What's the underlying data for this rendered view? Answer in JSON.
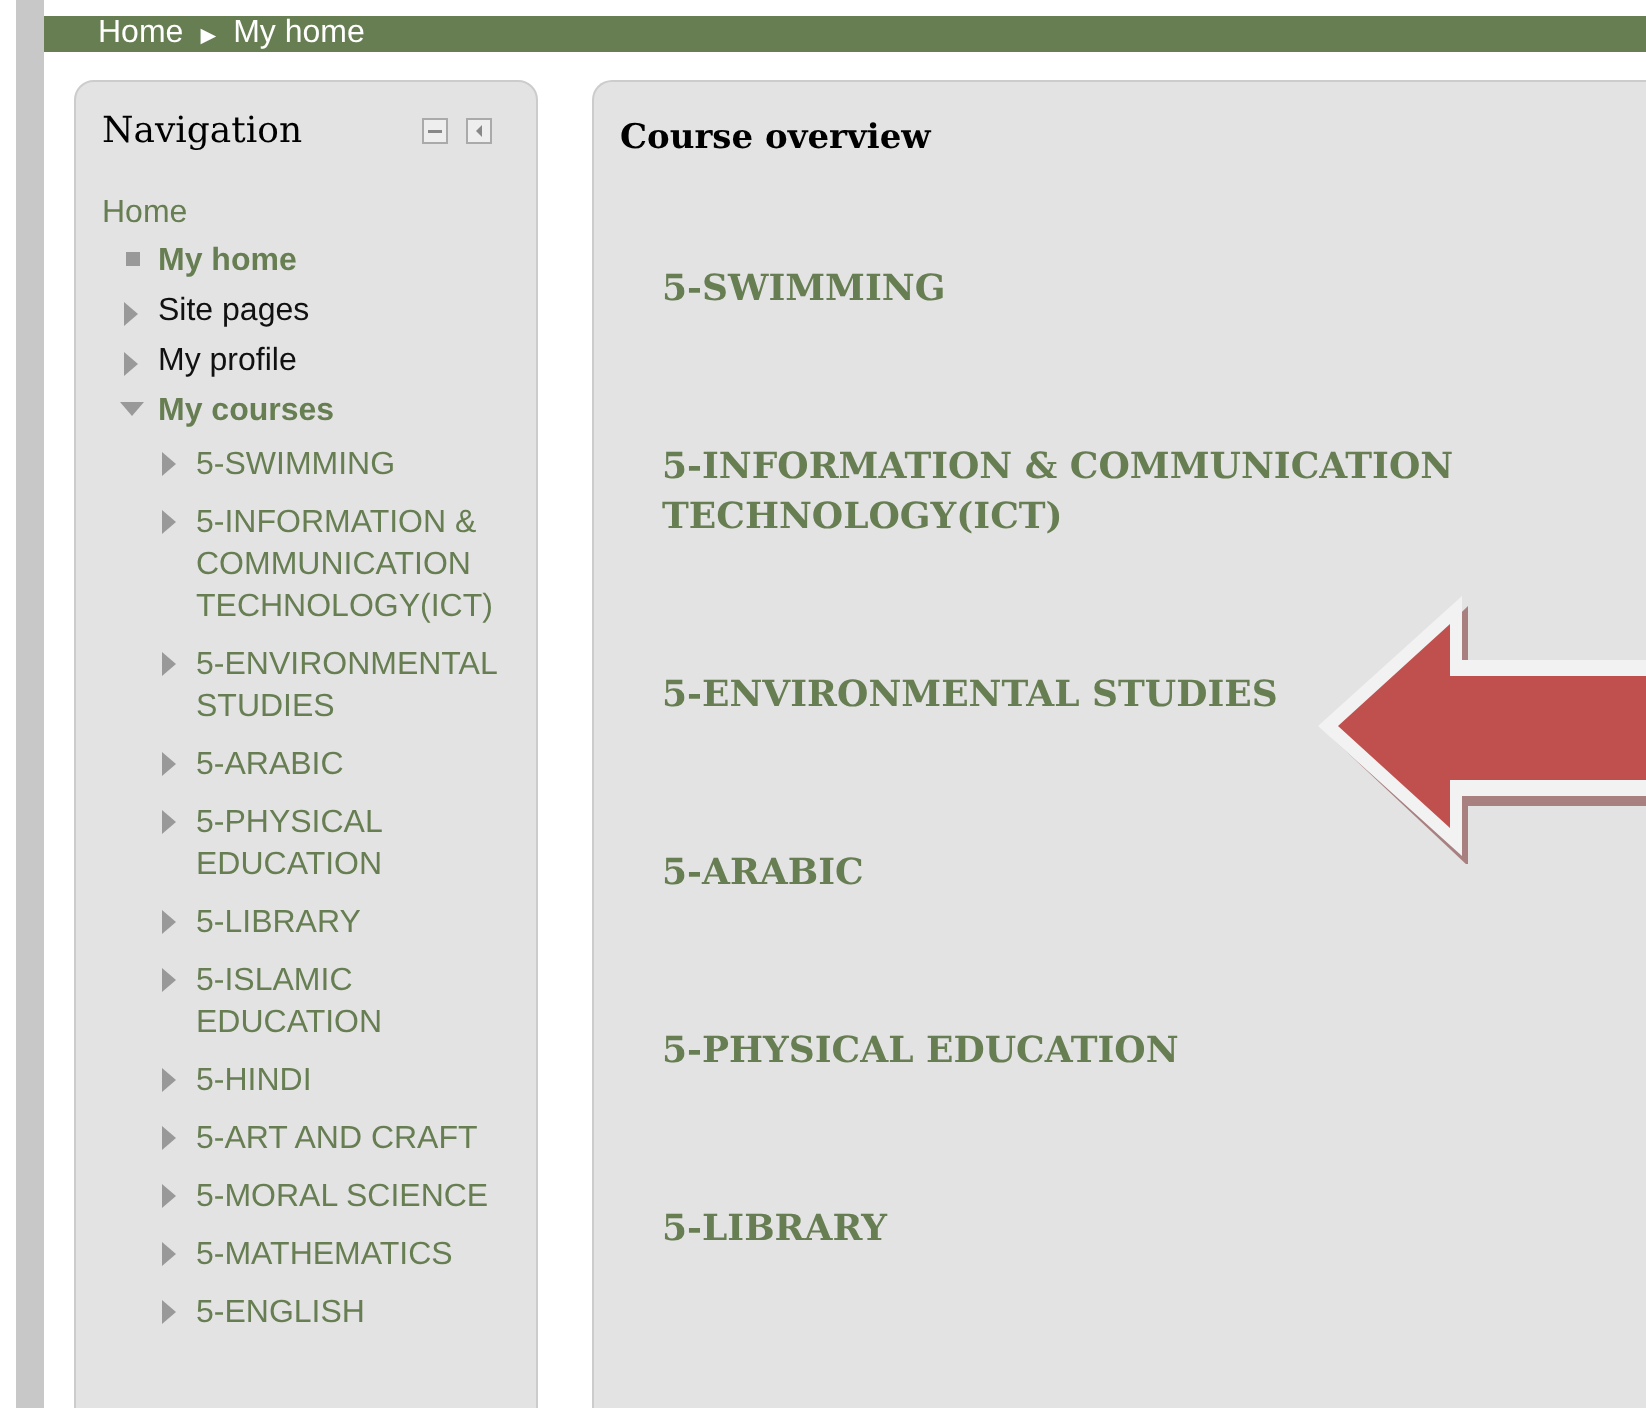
{
  "breadcrumb": {
    "items": [
      "Home",
      "My home"
    ],
    "separator": "►"
  },
  "navigation": {
    "title": "Navigation",
    "home": "Home",
    "items": [
      {
        "label": "My home",
        "kind": "leaf",
        "active": true
      },
      {
        "label": "Site pages",
        "kind": "branch",
        "active": false,
        "expanded": false
      },
      {
        "label": "My profile",
        "kind": "branch",
        "active": false,
        "expanded": false
      },
      {
        "label": "My courses",
        "kind": "branch",
        "active": true,
        "expanded": true,
        "children": [
          {
            "label": "5-SWIMMING",
            "expanded": false
          },
          {
            "label": "5-INFORMATION & COMMUNICATION TECHNOLOGY(ICT)",
            "expanded": false
          },
          {
            "label": "5-ENVIRONMENTAL STUDIES",
            "expanded": false
          },
          {
            "label": "5-ARABIC",
            "expanded": false
          },
          {
            "label": "5-PHYSICAL EDUCATION",
            "expanded": false
          },
          {
            "label": "5-LIBRARY",
            "expanded": false
          },
          {
            "label": "5-ISLAMIC EDUCATION",
            "expanded": false
          },
          {
            "label": "5-HINDI",
            "expanded": false
          },
          {
            "label": "5-ART AND CRAFT",
            "expanded": false
          },
          {
            "label": "5-MORAL SCIENCE",
            "expanded": false
          },
          {
            "label": "5-MATHEMATICS",
            "expanded": false
          },
          {
            "label": "5-ENGLISH",
            "expanded": false
          }
        ]
      }
    ]
  },
  "course_overview": {
    "title": "Course overview",
    "courses": [
      "5-SWIMMING",
      "5-INFORMATION & COMMUNICATION TECHNOLOGY(ICT)",
      "5-ENVIRONMENTAL STUDIES",
      "5-ARABIC",
      "5-PHYSICAL EDUCATION",
      "5-LIBRARY"
    ]
  }
}
